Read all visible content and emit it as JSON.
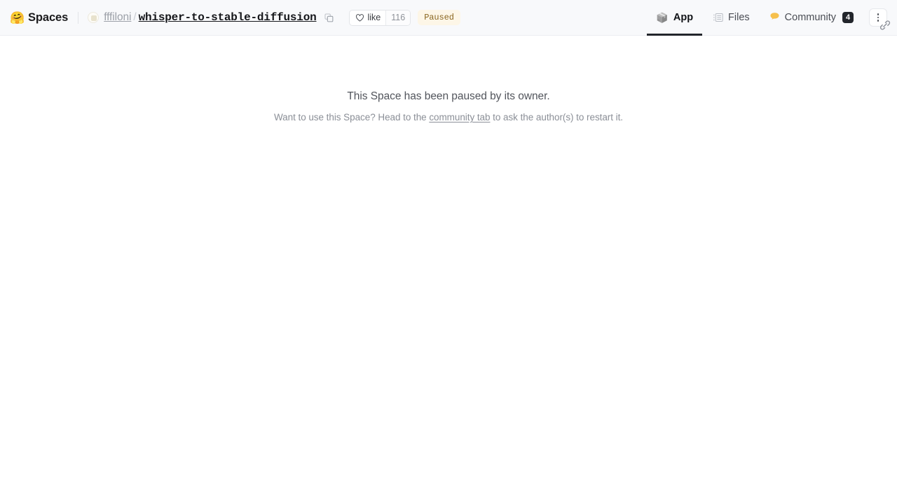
{
  "header": {
    "brand": {
      "emoji": "🤗",
      "label": "Spaces",
      "icon": "huggingface-logo-icon"
    },
    "repo": {
      "owner": "fffiloni",
      "separator": "/",
      "name": "whisper-to-stable-diffusion",
      "copy_icon": "copy-icon"
    },
    "like": {
      "icon": "heart-outline-icon",
      "label": "like",
      "count": "116"
    },
    "status": {
      "label": "Paused",
      "bg": "#fdf6e7",
      "fg": "#8a6620"
    },
    "tabs": [
      {
        "key": "app",
        "label": "App",
        "emoji": "📦",
        "icon": "box-icon",
        "active": true
      },
      {
        "key": "files",
        "label": "Files",
        "emoji": "",
        "icon": "files-list-icon",
        "active": false
      },
      {
        "key": "community",
        "label": "Community",
        "emoji": "🫓",
        "icon": "community-icon",
        "active": false,
        "badge": "4"
      }
    ],
    "menu_button": {
      "icon": "kebab-menu-icon",
      "label": ""
    },
    "cursor": {
      "icon": "link-cursor-icon"
    }
  },
  "main": {
    "title": "This Space has been paused by its owner.",
    "subtitle_before": "Want to use this Space? Head to the ",
    "subtitle_link": "community tab",
    "subtitle_after": " to ask the author(s) to restart it."
  },
  "colors": {
    "header_bg": "#f8f9fb",
    "header_border": "#eceef1",
    "accent_dark": "#22252b",
    "muted_text": "#8b8f97",
    "status_amber": "#8a6620"
  }
}
